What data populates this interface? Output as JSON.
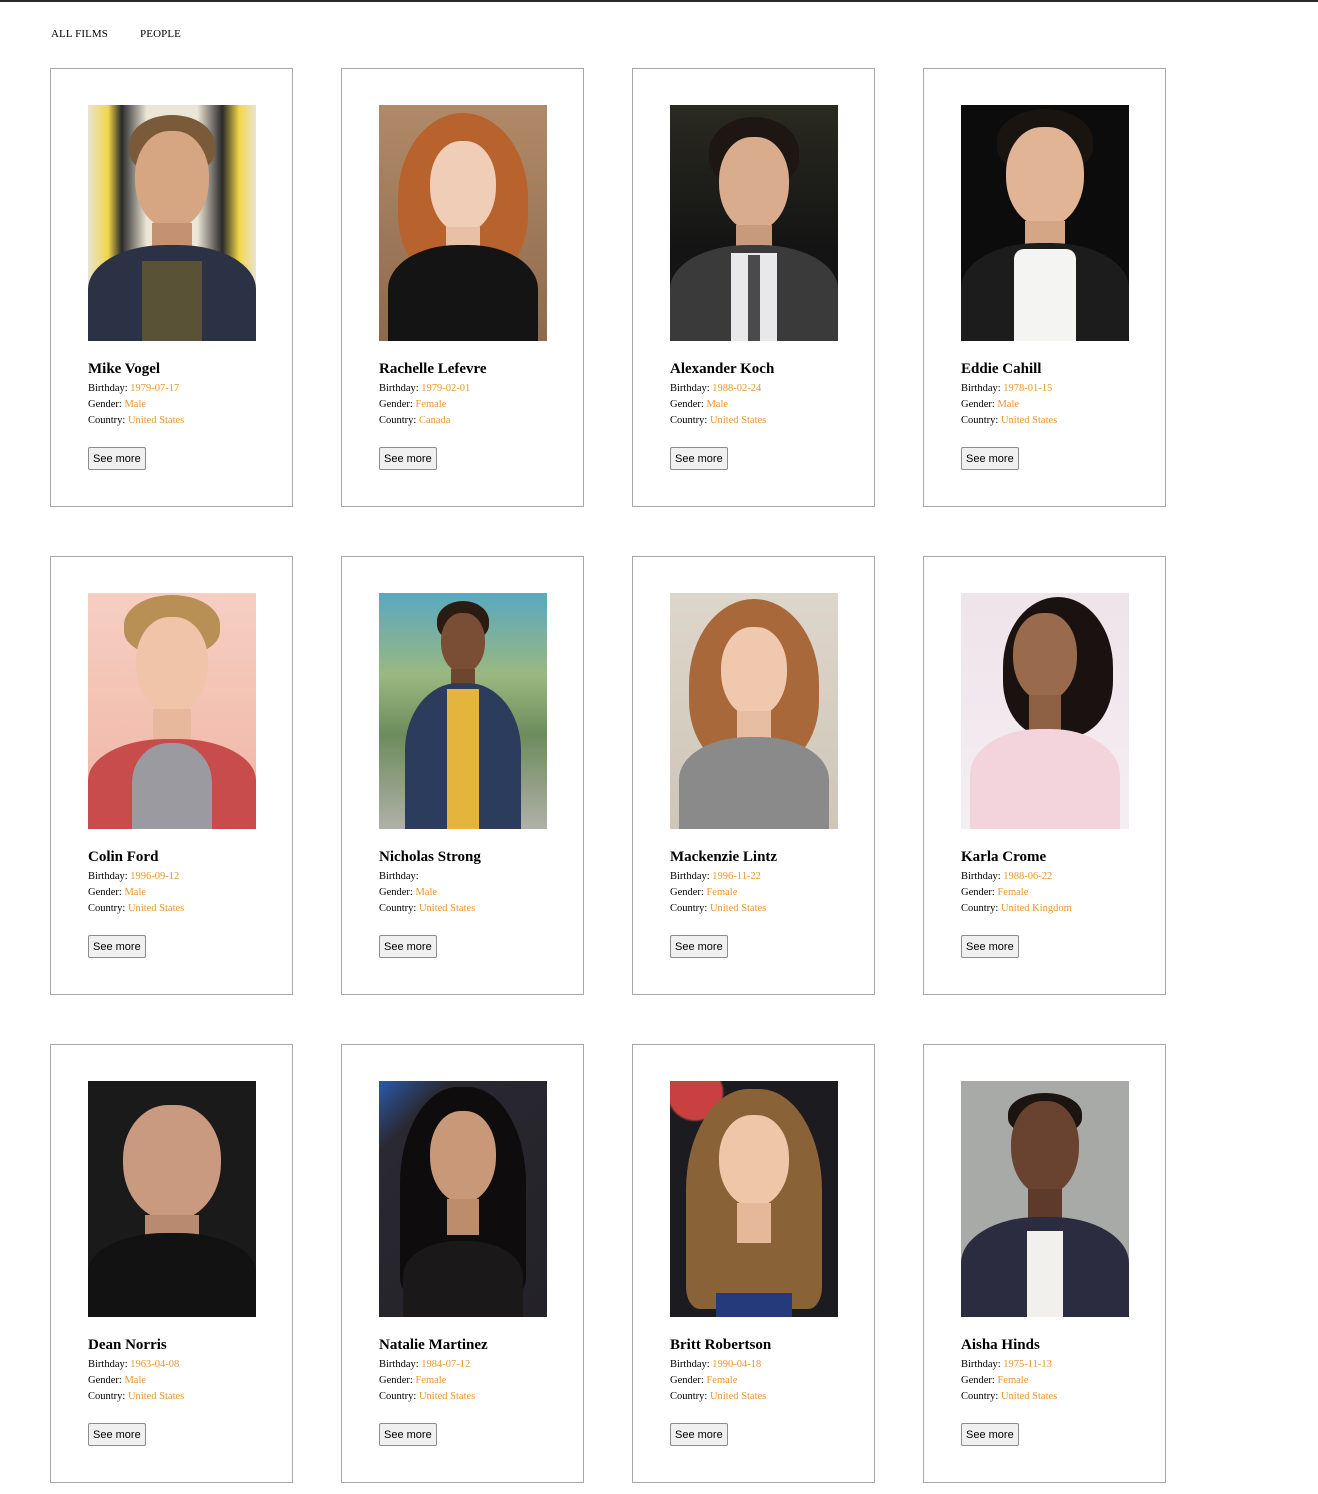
{
  "nav": {
    "films": "ALL FILMS",
    "people": "PEOPLE"
  },
  "labels": {
    "birthday": "Birthday:",
    "gender": "Gender:",
    "country": "Country:",
    "see_more": "See more"
  },
  "colors": {
    "value_accent": "#e8962a",
    "card_border": "#a8a8a8"
  },
  "people": [
    {
      "name": "Mike Vogel",
      "birthday": "1979-07-17",
      "gender": "Male",
      "country": "United States"
    },
    {
      "name": "Rachelle Lefevre",
      "birthday": "1979-02-01",
      "gender": "Female",
      "country": "Canada"
    },
    {
      "name": "Alexander Koch",
      "birthday": "1988-02-24",
      "gender": "Male",
      "country": "United States"
    },
    {
      "name": "Eddie Cahill",
      "birthday": "1978-01-15",
      "gender": "Male",
      "country": "United States"
    },
    {
      "name": "Colin Ford",
      "birthday": "1996-09-12",
      "gender": "Male",
      "country": "United States"
    },
    {
      "name": "Nicholas Strong",
      "birthday": "",
      "gender": "Male",
      "country": "United States"
    },
    {
      "name": "Mackenzie Lintz",
      "birthday": "1996-11-22",
      "gender": "Female",
      "country": "United States"
    },
    {
      "name": "Karla Crome",
      "birthday": "1988-06-22",
      "gender": "Female",
      "country": "United Kingdom"
    },
    {
      "name": "Dean Norris",
      "birthday": "1963-04-08",
      "gender": "Male",
      "country": "United States"
    },
    {
      "name": "Natalie Martinez",
      "birthday": "1984-07-12",
      "gender": "Female",
      "country": "United States"
    },
    {
      "name": "Britt Robertson",
      "birthday": "1990-04-18",
      "gender": "Female",
      "country": "United States"
    },
    {
      "name": "Aisha Hinds",
      "birthday": "1975-11-13",
      "gender": "Female",
      "country": "United States"
    }
  ]
}
